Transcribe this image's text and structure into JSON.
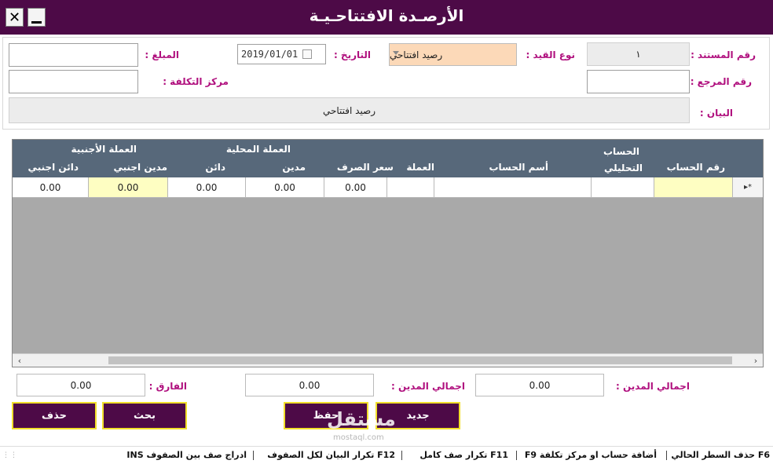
{
  "window": {
    "title": "الأرصـدة الافتتاحـيـة",
    "close_glyph": "✕"
  },
  "form": {
    "doc_no_label": "رقم المستند :",
    "doc_no_value": "١",
    "entry_type_label": "نوع القيد :",
    "entry_type_value": "رصيد افتتاحي",
    "date_label": "التاريخ :",
    "date_value": "2019/01/01",
    "amount_label": "المبلغ :",
    "ref_no_label": "رقم المرجع :",
    "cost_center_label": "مركز التكلفة :",
    "description_label": "البيان :",
    "description_value": "رصيد افتتاحي"
  },
  "grid": {
    "headers": {
      "account_no": "رقم الحساب",
      "analytic_1": "الحساب",
      "analytic_2": "التحليلي",
      "account_name": "أسم الحساب",
      "currency": "العملة",
      "rate": "سعر الصرف",
      "local_group": "العملة المحلية",
      "local_debit": "مدين",
      "local_credit": "دائن",
      "foreign_group": "العملة الأجنبية",
      "foreign_debit": "مدين اجنبي",
      "foreign_credit": "دائن اجنبي"
    },
    "row": {
      "marker": "▸*",
      "rate": "0.00",
      "local_debit": "0.00",
      "local_credit": "0.00",
      "foreign_debit": "0.00",
      "foreign_credit": "0.00"
    },
    "scroll_left": "‹",
    "scroll_right": "›"
  },
  "totals": {
    "debit_total_label_1": "اجمالي المدين :",
    "debit_total_value_1": "0.00",
    "debit_total_label_2": "اجمالي المدين :",
    "debit_total_value_2": "0.00",
    "difference_label": "الفارق :",
    "difference_value": "0.00"
  },
  "buttons": {
    "new": "جديد",
    "save": "حفظ",
    "search": "بحث",
    "delete": "حذف"
  },
  "statusbar": {
    "f6": "F6 حذف السطر الحالي",
    "f9": "أضافة حساب او مركز تكلفة F9",
    "f11": "F11 تكرار صف كامل",
    "f12": "F12 تكرار البيان لكل الصفوف",
    "ins": "ادراج صف بين الصفوف INS"
  },
  "watermark": {
    "text": "مستقل",
    "sub": "mostaql.com"
  },
  "colors": {
    "titlebar": "#4d0a47",
    "label": "#b0107e",
    "grid_header": "#57687a",
    "button_border": "#f1df2b"
  }
}
